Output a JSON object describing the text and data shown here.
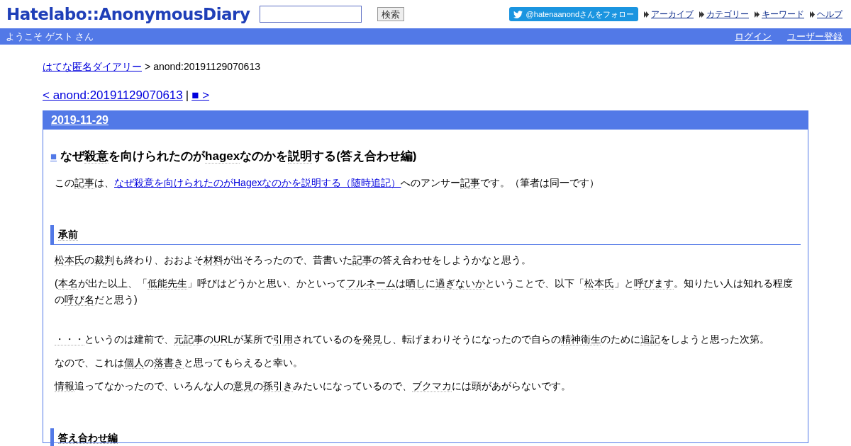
{
  "header": {
    "logo": "Hatelabo::AnonymousDiary",
    "search_button": "検索",
    "follow_button": "@hatenaanondさんをフォロー",
    "nav_links": [
      "アーカイブ",
      "カテゴリー",
      "キーワード",
      "ヘルプ"
    ]
  },
  "welcome_bar": {
    "greeting": "ようこそ ゲスト さん",
    "links": [
      "ログイン",
      "ユーザー登録"
    ]
  },
  "breadcrumb": {
    "link": "はてな匿名ダイアリー",
    "separator": ">",
    "current": "anond:20191129070613"
  },
  "pager": {
    "prev": "< anond:20191129070613",
    "separator": "|",
    "next": "■ >"
  },
  "day": {
    "date": "2019-11-29",
    "entry": {
      "mark": "■",
      "title": [
        {
          "kind": "text",
          "text": "なぜ"
        },
        {
          "kind": "keyword",
          "text": "殺意"
        },
        {
          "kind": "text",
          "text": "を向けられたのが"
        },
        {
          "kind": "keyword",
          "text": "hagex"
        },
        {
          "kind": "text",
          "text": "なのかを"
        },
        {
          "kind": "keyword",
          "text": "説明"
        },
        {
          "kind": "text",
          "text": "する(答え合わせ編)"
        }
      ],
      "body": [
        {
          "kind": "paragraph",
          "segments": [
            {
              "kind": "text",
              "text": "この"
            },
            {
              "kind": "keyword",
              "text": "記事"
            },
            {
              "kind": "text",
              "text": "は、"
            },
            {
              "kind": "link",
              "text": "なぜ殺意を向けられたのがHagexなのかを説明する（随時追記）"
            },
            {
              "kind": "text",
              "text": "へのアンサー"
            },
            {
              "kind": "keyword",
              "text": "記事"
            },
            {
              "kind": "text",
              "text": "です。（筆者は同一です）"
            }
          ]
        },
        {
          "kind": "heading",
          "segments": [
            {
              "kind": "keyword",
              "text": "承前"
            }
          ]
        },
        {
          "kind": "paragraph",
          "segments": [
            {
              "kind": "keyword",
              "text": "松本氏"
            },
            {
              "kind": "text",
              "text": "の"
            },
            {
              "kind": "keyword",
              "text": "裁判"
            },
            {
              "kind": "text",
              "text": "も終わり、おおよそ"
            },
            {
              "kind": "keyword",
              "text": "材料"
            },
            {
              "kind": "text",
              "text": "が出そろったので、昔書いた"
            },
            {
              "kind": "keyword",
              "text": "記事"
            },
            {
              "kind": "text",
              "text": "の答え合わせをしようかなと思う。"
            }
          ]
        },
        {
          "kind": "paragraph",
          "segments": [
            {
              "kind": "text",
              "text": "("
            },
            {
              "kind": "keyword",
              "text": "本名"
            },
            {
              "kind": "text",
              "text": "が出た以上、「"
            },
            {
              "kind": "keyword",
              "text": "低能先生"
            },
            {
              "kind": "text",
              "text": "」呼びはどうかと思い、かといって"
            },
            {
              "kind": "keyword",
              "text": "フルネーム"
            },
            {
              "kind": "text",
              "text": "は"
            },
            {
              "kind": "keyword",
              "text": "晒し"
            },
            {
              "kind": "text",
              "text": "に"
            },
            {
              "kind": "keyword",
              "text": "過ぎないか"
            },
            {
              "kind": "text",
              "text": "ということで、以下「"
            },
            {
              "kind": "keyword",
              "text": "松本氏"
            },
            {
              "kind": "text",
              "text": "」と"
            },
            {
              "kind": "keyword",
              "text": "呼びます"
            },
            {
              "kind": "text",
              "text": "。知りたい人は知れる程度の"
            },
            {
              "kind": "keyword",
              "text": "呼び名"
            },
            {
              "kind": "text",
              "text": "だと思う)"
            }
          ]
        },
        {
          "kind": "blank"
        },
        {
          "kind": "paragraph",
          "segments": [
            {
              "kind": "keyword",
              "text": "・・・"
            },
            {
              "kind": "text",
              "text": "というのは建前で、"
            },
            {
              "kind": "keyword",
              "text": "元記事"
            },
            {
              "kind": "text",
              "text": "の"
            },
            {
              "kind": "keyword",
              "text": "URL"
            },
            {
              "kind": "text",
              "text": "が某所で"
            },
            {
              "kind": "keyword",
              "text": "引用"
            },
            {
              "kind": "text",
              "text": "されているのを"
            },
            {
              "kind": "keyword",
              "text": "発見"
            },
            {
              "kind": "text",
              "text": "し、転げまわりそうになったので自らの"
            },
            {
              "kind": "keyword",
              "text": "精神衛生"
            },
            {
              "kind": "text",
              "text": "のために"
            },
            {
              "kind": "keyword",
              "text": "追記"
            },
            {
              "kind": "text",
              "text": "をしようと思った次第。"
            }
          ]
        },
        {
          "kind": "paragraph",
          "segments": [
            {
              "kind": "text",
              "text": "なので、これは"
            },
            {
              "kind": "keyword",
              "text": "個人"
            },
            {
              "kind": "text",
              "text": "の"
            },
            {
              "kind": "keyword",
              "text": "落書き"
            },
            {
              "kind": "text",
              "text": "と思ってもらえると幸い。"
            }
          ]
        },
        {
          "kind": "paragraph",
          "segments": [
            {
              "kind": "keyword",
              "text": "情報"
            },
            {
              "kind": "text",
              "text": "追ってなかったので、いろんな人の"
            },
            {
              "kind": "keyword",
              "text": "意見"
            },
            {
              "kind": "text",
              "text": "の"
            },
            {
              "kind": "keyword",
              "text": "孫引き"
            },
            {
              "kind": "text",
              "text": "みたいになっているので、"
            },
            {
              "kind": "keyword",
              "text": "ブクマカ"
            },
            {
              "kind": "text",
              "text": "には頭があがらないです。"
            }
          ]
        },
        {
          "kind": "heading",
          "segments": [
            {
              "kind": "keyword",
              "text": "答え合わせ編"
            }
          ]
        }
      ]
    }
  }
}
